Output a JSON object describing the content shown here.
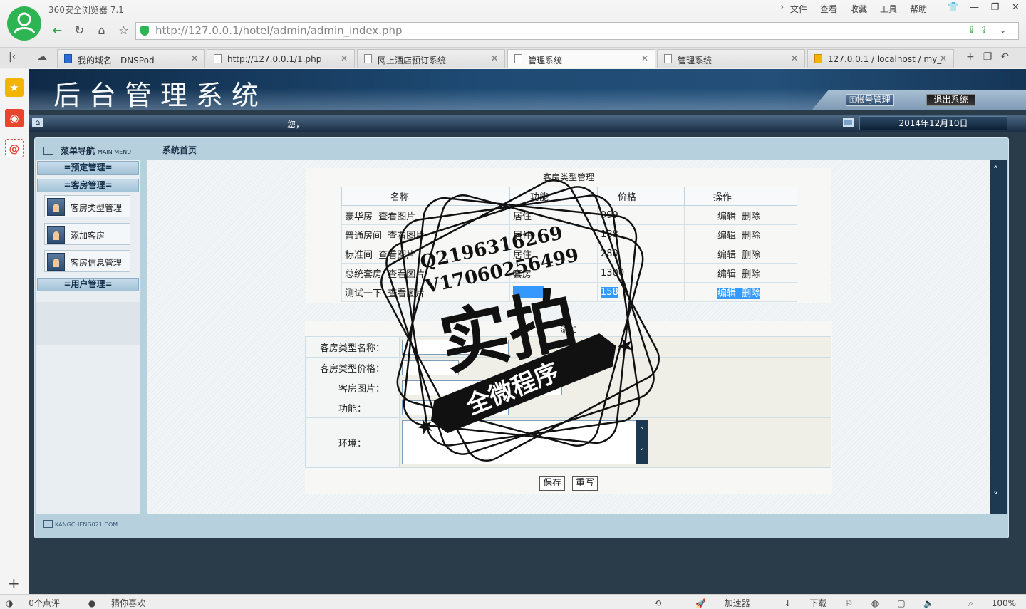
{
  "browser": {
    "title": "360安全浏览器 7.1",
    "menu": [
      "文件",
      "查看",
      "收藏",
      "工具",
      "帮助"
    ],
    "url": "http://127.0.0.1/hotel/admin/admin_index.php",
    "tabs": [
      {
        "label": "我的域名 - DNSPod",
        "active": false
      },
      {
        "label": "http://127.0.0.1/1.php",
        "active": false
      },
      {
        "label": "网上酒店预订系统",
        "active": false
      },
      {
        "label": "管理系统",
        "active": true
      },
      {
        "label": "管理系统",
        "active": false
      },
      {
        "label": "127.0.0.1 / localhost / my_",
        "active": false
      }
    ],
    "status_left": [
      "0个点评",
      "猜你喜欢"
    ],
    "status_right": [
      "加速器",
      "下载",
      "100%"
    ],
    "accent_color": "#2fb454"
  },
  "admin": {
    "banner_title": "后台管理系统",
    "account_button": "帐号管理",
    "logout_button": "退出系统",
    "greeting": "您，",
    "date": "2014年12月10日",
    "menu_title": "菜单导航",
    "menu_title_en": "MAIN MENU",
    "breadcrumb": "系统首页",
    "footer_logo": "KANGCHENG021.COM",
    "sidebar": {
      "section_booking": "=预定管理=",
      "section_rooms": "=客房管理=",
      "items": [
        "客房类型管理",
        "添加客房",
        "客房信息管理"
      ],
      "section_users": "=用户管理="
    }
  },
  "room_types": {
    "title": "客房类型管理",
    "columns": [
      "名称",
      "功能",
      "价格",
      "操作"
    ],
    "view_image": "查看图片",
    "edit": "编辑",
    "delete": "删除",
    "rows": [
      {
        "name": "豪华房",
        "function": "居住",
        "price": "999"
      },
      {
        "name": "普通房间",
        "function": "居住",
        "price": "188"
      },
      {
        "name": "标准间",
        "function": "居住",
        "price": "280"
      },
      {
        "name": "总统套房",
        "function": "套房",
        "price": "1300"
      },
      {
        "name": "测试一下",
        "function": "",
        "price": "158"
      }
    ]
  },
  "add_form": {
    "title": "添加",
    "label_type_name": "客房类型名称：",
    "label_type_price": "客房类型价格：",
    "label_image": "客房图片：",
    "label_function": "功能：",
    "label_environment": "环境：",
    "save_button": "保存",
    "reset_button": "重写"
  },
  "watermark": {
    "line1": "Q2196316269",
    "line2": "V17060256499",
    "big": "实拍",
    "ribbon": "全微程序"
  }
}
